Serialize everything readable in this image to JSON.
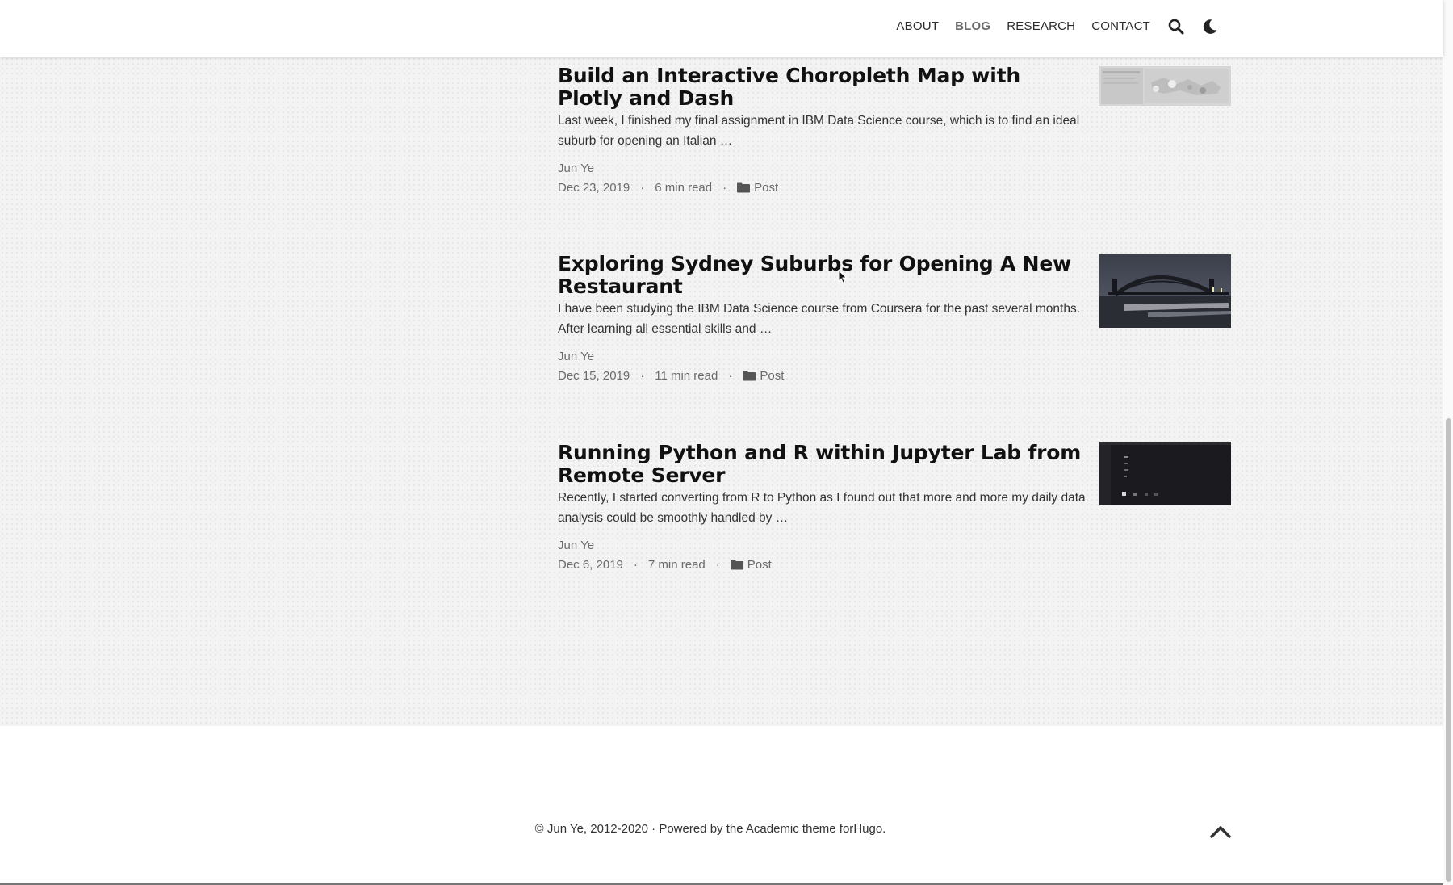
{
  "navbar": {
    "items": [
      {
        "label": "ABOUT"
      },
      {
        "label": "BLOG"
      },
      {
        "label": "RESEARCH"
      },
      {
        "label": "CONTACT"
      }
    ],
    "search_icon": "search-icon",
    "theme_icon": "moon-icon"
  },
  "posts": [
    {
      "title": "Build an Interactive Choropleth Map with Plotly and Dash",
      "summary": "Last week, I finished my final assignment in IBM Data Science course, which is to find an ideal suburb for opening an Italian …",
      "author": "Jun Ye",
      "date": "Dec 23, 2019",
      "read_time": "6 min read",
      "category": "Post"
    },
    {
      "title": "Exploring Sydney Suburbs for Opening A New Restaurant",
      "summary": "I have been studying the IBM Data Science course from Coursera for the past several months. After learning all essential skills and …",
      "author": "Jun Ye",
      "date": "Dec 15, 2019",
      "read_time": "11 min read",
      "category": "Post"
    },
    {
      "title": "Running Python and R within Jupyter Lab from Remote Server",
      "summary": "Recently, I started converting from R to Python as I found out that more and more my daily data analysis could be smoothly handled by …",
      "author": "Jun Ye",
      "date": "Dec 6, 2019",
      "read_time": "7 min read",
      "category": "Post"
    }
  ],
  "meta_separator": "·",
  "footer": {
    "copyright": "© Jun Ye, 2012-2020 · Powered by the",
    "theme_link": "Academic theme",
    "for_text": "for",
    "hugo_link": "Hugo",
    "period": "."
  },
  "colors": {
    "text": "#111111",
    "meta": "#6b6b6b",
    "background": "#f3f3f3"
  }
}
